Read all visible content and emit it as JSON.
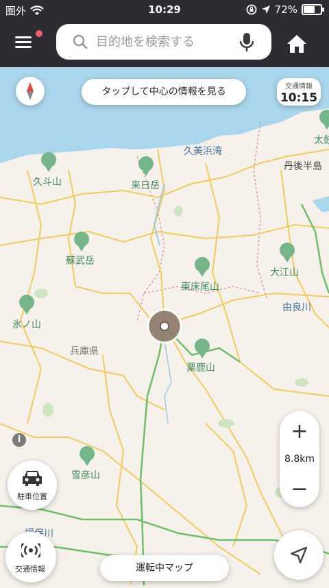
{
  "status_bar": {
    "carrier": "圏外",
    "time": "10:29",
    "battery_percent": "72%",
    "battery_level": 0.72
  },
  "header": {
    "search_placeholder": "目的地を検索する"
  },
  "map": {
    "center_info_button": "タップして中心の情報を見る",
    "traffic_info_label": "交通情報",
    "traffic_info_time": "10:15",
    "scale_label": "8.8km",
    "places": [
      {
        "name": "久美浜湾",
        "type": "water"
      },
      {
        "name": "丹後半島",
        "type": "area"
      },
      {
        "name": "太鼓",
        "type": "mountain"
      },
      {
        "name": "久斗山",
        "type": "mountain"
      },
      {
        "name": "来日岳",
        "type": "mountain"
      },
      {
        "name": "蘇武岳",
        "type": "mountain"
      },
      {
        "name": "東床尾山",
        "type": "mountain"
      },
      {
        "name": "大江山",
        "type": "mountain"
      },
      {
        "name": "由良川",
        "type": "water"
      },
      {
        "name": "氷ノ山",
        "type": "mountain"
      },
      {
        "name": "兵庫県",
        "type": "area"
      },
      {
        "name": "粟鹿山",
        "type": "mountain"
      },
      {
        "name": "雪彦山",
        "type": "mountain"
      },
      {
        "name": "揖保川",
        "type": "water"
      }
    ]
  },
  "buttons": {
    "parking_label": "駐車位置",
    "traffic_label": "交通情報",
    "drive_map_label": "運転中マップ",
    "zoom_in": "+",
    "zoom_out": "−"
  },
  "icons": {
    "menu": "menu-icon",
    "search": "search-icon",
    "mic": "mic-icon",
    "home": "home-icon",
    "compass": "compass-icon",
    "car": "car-icon",
    "broadcast": "broadcast-icon",
    "locate": "navigation-arrow-icon",
    "info": "info-icon"
  }
}
